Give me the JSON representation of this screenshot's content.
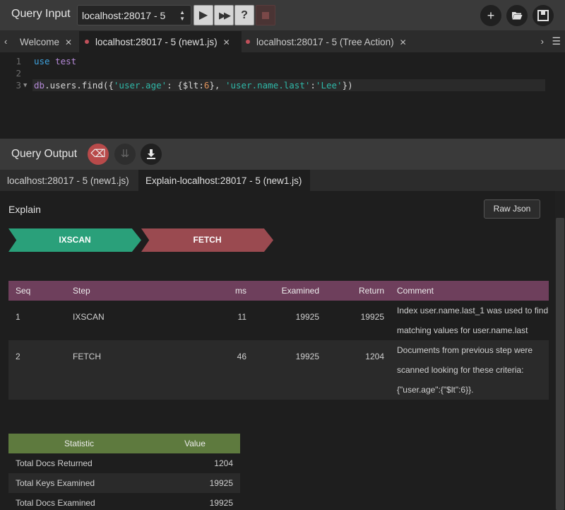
{
  "toolbar": {
    "title": "Query Input",
    "connection": "localhost:28017 - 5",
    "run_icon": "play-icon",
    "run_all_icon": "fast-forward-icon",
    "help_label": "?",
    "stop_icon": "stop-icon",
    "add_icon": "plus-icon",
    "open_icon": "folder-open-icon",
    "save_icon": "save-icon"
  },
  "editor_tabs": [
    {
      "label": "Welcome",
      "modified": false
    },
    {
      "label": "localhost:28017 - 5 (new1.js)",
      "modified": true
    },
    {
      "label": "localhost:28017 - 5 (Tree Action)",
      "modified": true
    }
  ],
  "editor": {
    "lines": [
      "1",
      "2",
      "3"
    ],
    "line1_kw": "use",
    "line1_db": "test",
    "line3": {
      "db": "db",
      "p1": ".users.find({",
      "s1": "'user.age'",
      "p2": ": {$lt:",
      "n1": "6",
      "p3": "}, ",
      "s2": "'user.name.last'",
      "p4": ":",
      "s3": "'Lee'",
      "p5": "})"
    }
  },
  "output": {
    "title": "Query Output",
    "tabs": [
      "localhost:28017 - 5 (new1.js)",
      "Explain-localhost:28017 - 5 (new1.js)"
    ]
  },
  "explain": {
    "title": "Explain",
    "raw_json_label": "Raw Json",
    "stages": [
      "IXSCAN",
      "FETCH"
    ],
    "stage_colors": [
      "#2aa07a",
      "#9a4a50"
    ],
    "steps_headers": [
      "Seq",
      "Step",
      "ms",
      "Examined",
      "Return",
      "Comment"
    ],
    "steps": [
      {
        "seq": "1",
        "step": "IXSCAN",
        "ms": "11",
        "examined": "19925",
        "return": "19925",
        "comment": [
          "Index user.name.last_1 was used to find",
          "matching values for user.name.last"
        ]
      },
      {
        "seq": "2",
        "step": "FETCH",
        "ms": "46",
        "examined": "19925",
        "return": "1204",
        "comment": [
          "Documents from previous step were",
          "scanned looking for these criteria:",
          "{\"user.age\":{\"$lt\":6}}."
        ]
      }
    ],
    "stats_headers": [
      "Statistic",
      "Value"
    ],
    "stats": [
      {
        "name": "Total Docs Returned",
        "value": "1204"
      },
      {
        "name": "Total Keys Examined",
        "value": "19925"
      },
      {
        "name": "Total Docs Examined",
        "value": "19925"
      }
    ]
  }
}
